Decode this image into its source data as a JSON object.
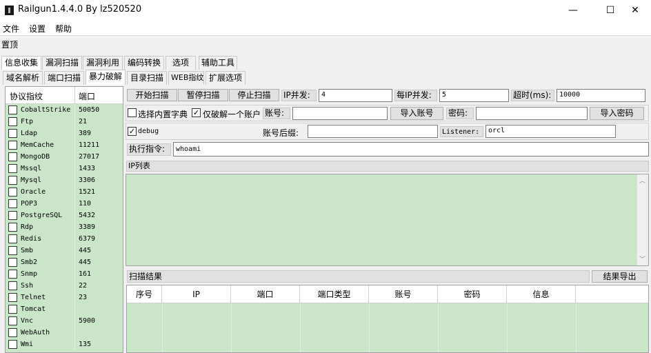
{
  "window": {
    "title": "Railgun1.4.4.0 By lz520520",
    "minimize_glyph": "—",
    "maximize_glyph": "☐",
    "close_glyph": "✕"
  },
  "menu": [
    "文件",
    "设置",
    "帮助"
  ],
  "pin_label": "置顶",
  "main_tabs": [
    "信息收集",
    "漏洞扫描",
    "漏洞利用",
    "编码转换",
    "选项",
    "辅助工具"
  ],
  "sub_tabs": [
    "域名解析",
    "端口扫描",
    "暴力破解"
  ],
  "panel_tabs": [
    "目录扫描",
    "WEB指纹",
    "扩展选项"
  ],
  "proto_table": {
    "col_protocol": "协议指纹",
    "col_port": "端口",
    "rows": [
      {
        "name": "CobaltStrike",
        "port": "50050"
      },
      {
        "name": "Ftp",
        "port": "21"
      },
      {
        "name": "Ldap",
        "port": "389"
      },
      {
        "name": "MemCache",
        "port": "11211"
      },
      {
        "name": "MongoDB",
        "port": "27017"
      },
      {
        "name": "Mssql",
        "port": "1433"
      },
      {
        "name": "Mysql",
        "port": "3306"
      },
      {
        "name": "Oracle",
        "port": "1521"
      },
      {
        "name": "POP3",
        "port": "110"
      },
      {
        "name": "PostgreSQL",
        "port": "5432"
      },
      {
        "name": "Rdp",
        "port": "3389"
      },
      {
        "name": "Redis",
        "port": "6379"
      },
      {
        "name": "Smb",
        "port": "445"
      },
      {
        "name": "Smb2",
        "port": "445"
      },
      {
        "name": "Snmp",
        "port": "161"
      },
      {
        "name": "Ssh",
        "port": "22"
      },
      {
        "name": "Telnet",
        "port": "23"
      },
      {
        "name": "Tomcat",
        "port": ""
      },
      {
        "name": "Vnc",
        "port": "5900"
      },
      {
        "name": "WebAuth",
        "port": ""
      },
      {
        "name": "Wmi",
        "port": "135"
      }
    ]
  },
  "controls": {
    "start_scan": "开始扫描",
    "pause_scan": "暂停扫描",
    "stop_scan": "停止扫描",
    "ip_concurrency_label": "IP并发:",
    "ip_concurrency_value": "4",
    "per_ip_concurrency_label": "每IP并发:",
    "per_ip_concurrency_value": "5",
    "timeout_label": "超时(ms):",
    "timeout_value": "10000",
    "builtin_dict_label": "选择内置字典",
    "only_one_account_label": "仅破解一个账户",
    "account_label": "账号:",
    "account_value": "",
    "import_account": "导入账号",
    "password_label": "密码:",
    "password_value": "",
    "import_password": "导入密码",
    "debug_label": "debug",
    "account_suffix_label": "账号后缀:",
    "account_suffix_value": "",
    "listener_label": "Listener:",
    "listener_value": "orcl",
    "exec_cmd_label": "执行指令:",
    "exec_cmd_value": "whoami",
    "ip_list_label": "IP列表",
    "scan_result_label": "扫描结果",
    "export_result": "结果导出"
  },
  "result_columns": [
    "序号",
    "IP",
    "端口",
    "端口类型",
    "账号",
    "密码",
    "信息"
  ]
}
